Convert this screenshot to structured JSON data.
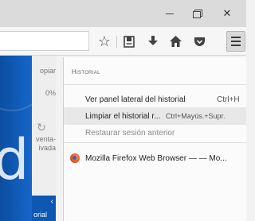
{
  "window": {
    "minimize_glyph": "–",
    "close_glyph": "✕"
  },
  "toolbar": {
    "icons": [
      "star-icon",
      "reading-list-icon",
      "download-icon",
      "home-icon",
      "pocket-icon",
      "menu-icon"
    ],
    "star_glyph": "☆",
    "download_glyph": "⬇",
    "home_glyph": "⌂"
  },
  "page": {
    "items": [
      "opiar",
      "0%",
      "venta-",
      "ivada"
    ],
    "ghost_text": "d",
    "side_tab_label": "orial",
    "side_tab_arrow": "‹"
  },
  "history_panel": {
    "title": "Historial",
    "items": [
      {
        "label": "Ver panel lateral del historial",
        "shortcut": "Ctrl+H",
        "state": "normal"
      },
      {
        "label": "Limpiar el historial r...",
        "shortcut": "Ctrl+Mayús.+Supr.",
        "state": "hover"
      },
      {
        "label": "Restaurar sesión anterior",
        "shortcut": "",
        "state": "disabled"
      }
    ],
    "recent": [
      {
        "label": "Mozilla Firefox Web Browser — — Mo...",
        "icon": "firefox-icon"
      }
    ]
  },
  "colors": {
    "accent_blue": "#0e57b3",
    "panel_bg": "#fbfbfb",
    "hover_bg": "#e8e8e8"
  }
}
